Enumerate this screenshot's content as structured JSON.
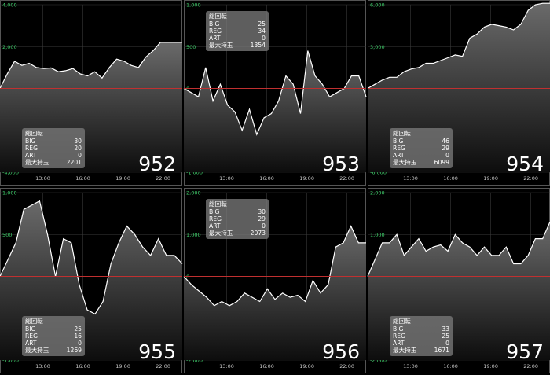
{
  "stats_title": "総回転",
  "labels": {
    "big": "BIG",
    "reg": "REG",
    "art": "ART",
    "max": "最大持玉"
  },
  "colors": {
    "zero_line": "#c03030",
    "grid": "#3a3a3a",
    "line": "#ffffff",
    "ytick": "#3ecf6a"
  },
  "chart_data": [
    {
      "type": "area",
      "machine": "952",
      "stats": {
        "big": "30",
        "reg": "20",
        "art": "0",
        "max": "2201"
      },
      "yticks": [
        "4,000",
        "2,000",
        "0",
        "-2,000",
        "-4,000"
      ],
      "ylim": [
        -4000,
        4000
      ],
      "xticks": [
        "13:00",
        "16:00",
        "19:00",
        "22:00"
      ],
      "values": [
        0,
        700,
        1300,
        1100,
        1200,
        1000,
        950,
        980,
        800,
        850,
        950,
        700,
        600,
        800,
        500,
        1000,
        1400,
        1300,
        1100,
        1000,
        1500,
        1800,
        2200,
        2200,
        2200,
        2200
      ]
    },
    {
      "type": "area",
      "machine": "953",
      "stats": {
        "big": "25",
        "reg": "34",
        "art": "0",
        "max": "1354"
      },
      "yticks": [
        "1,000",
        "500",
        "0",
        "-500",
        "-1,000"
      ],
      "ylim": [
        -1000,
        1000
      ],
      "xticks": [
        "13:00",
        "16:00",
        "19:00",
        "22:00"
      ],
      "values": [
        0,
        -50,
        -100,
        250,
        -150,
        50,
        -200,
        -280,
        -500,
        -250,
        -550,
        -350,
        -300,
        -150,
        150,
        50,
        -300,
        450,
        150,
        50,
        -100,
        -50,
        0,
        150,
        150,
        -100
      ]
    },
    {
      "type": "area",
      "machine": "954",
      "stats": {
        "big": "46",
        "reg": "29",
        "art": "0",
        "max": "6099"
      },
      "yticks": [
        "6,000",
        "3,000",
        "0",
        "-3,000",
        "-6,000"
      ],
      "ylim": [
        -6000,
        6000
      ],
      "xticks": [
        "13:00",
        "16:00",
        "19:00",
        "22:00"
      ],
      "values": [
        0,
        300,
        600,
        800,
        800,
        1200,
        1400,
        1500,
        1800,
        1800,
        2000,
        2200,
        2400,
        2300,
        3600,
        3900,
        4400,
        4600,
        4500,
        4400,
        4200,
        4600,
        5600,
        6000,
        6100,
        6100
      ]
    },
    {
      "type": "area",
      "machine": "955",
      "stats": {
        "big": "25",
        "reg": "16",
        "art": "0",
        "max": "1269"
      },
      "yticks": [
        "1,000",
        "500",
        "0",
        "-500",
        "-1,000"
      ],
      "ylim": [
        -1000,
        1000
      ],
      "xticks": [
        "13:00",
        "16:00",
        "19:00",
        "22:00"
      ],
      "values": [
        0,
        200,
        400,
        800,
        850,
        900,
        500,
        0,
        450,
        400,
        -100,
        -400,
        -450,
        -300,
        150,
        400,
        600,
        500,
        350,
        250,
        450,
        250,
        250,
        150
      ]
    },
    {
      "type": "area",
      "machine": "956",
      "stats": {
        "big": "30",
        "reg": "29",
        "art": "0",
        "max": "2073"
      },
      "yticks": [
        "2,000",
        "1,000",
        "0",
        "-1,000",
        "-2,000"
      ],
      "ylim": [
        -2000,
        2000
      ],
      "xticks": [
        "13:00",
        "16:00",
        "19:00",
        "22:00"
      ],
      "values": [
        0,
        -200,
        -350,
        -500,
        -700,
        -600,
        -700,
        -600,
        -400,
        -500,
        -600,
        -300,
        -550,
        -400,
        -500,
        -450,
        -600,
        -100,
        -400,
        -200,
        700,
        800,
        1200,
        800,
        800
      ]
    },
    {
      "type": "area",
      "machine": "957",
      "stats": {
        "big": "33",
        "reg": "25",
        "art": "0",
        "max": "1671"
      },
      "yticks": [
        "2,000",
        "1,000",
        "0",
        "-1,000",
        "-2,000"
      ],
      "ylim": [
        -2000,
        2000
      ],
      "xticks": [
        "13:00",
        "16:00",
        "19:00",
        "22:00"
      ],
      "values": [
        0,
        400,
        800,
        800,
        1000,
        500,
        700,
        900,
        600,
        700,
        750,
        600,
        1000,
        800,
        700,
        500,
        700,
        500,
        500,
        700,
        300,
        300,
        500,
        900,
        900,
        1300
      ]
    }
  ]
}
